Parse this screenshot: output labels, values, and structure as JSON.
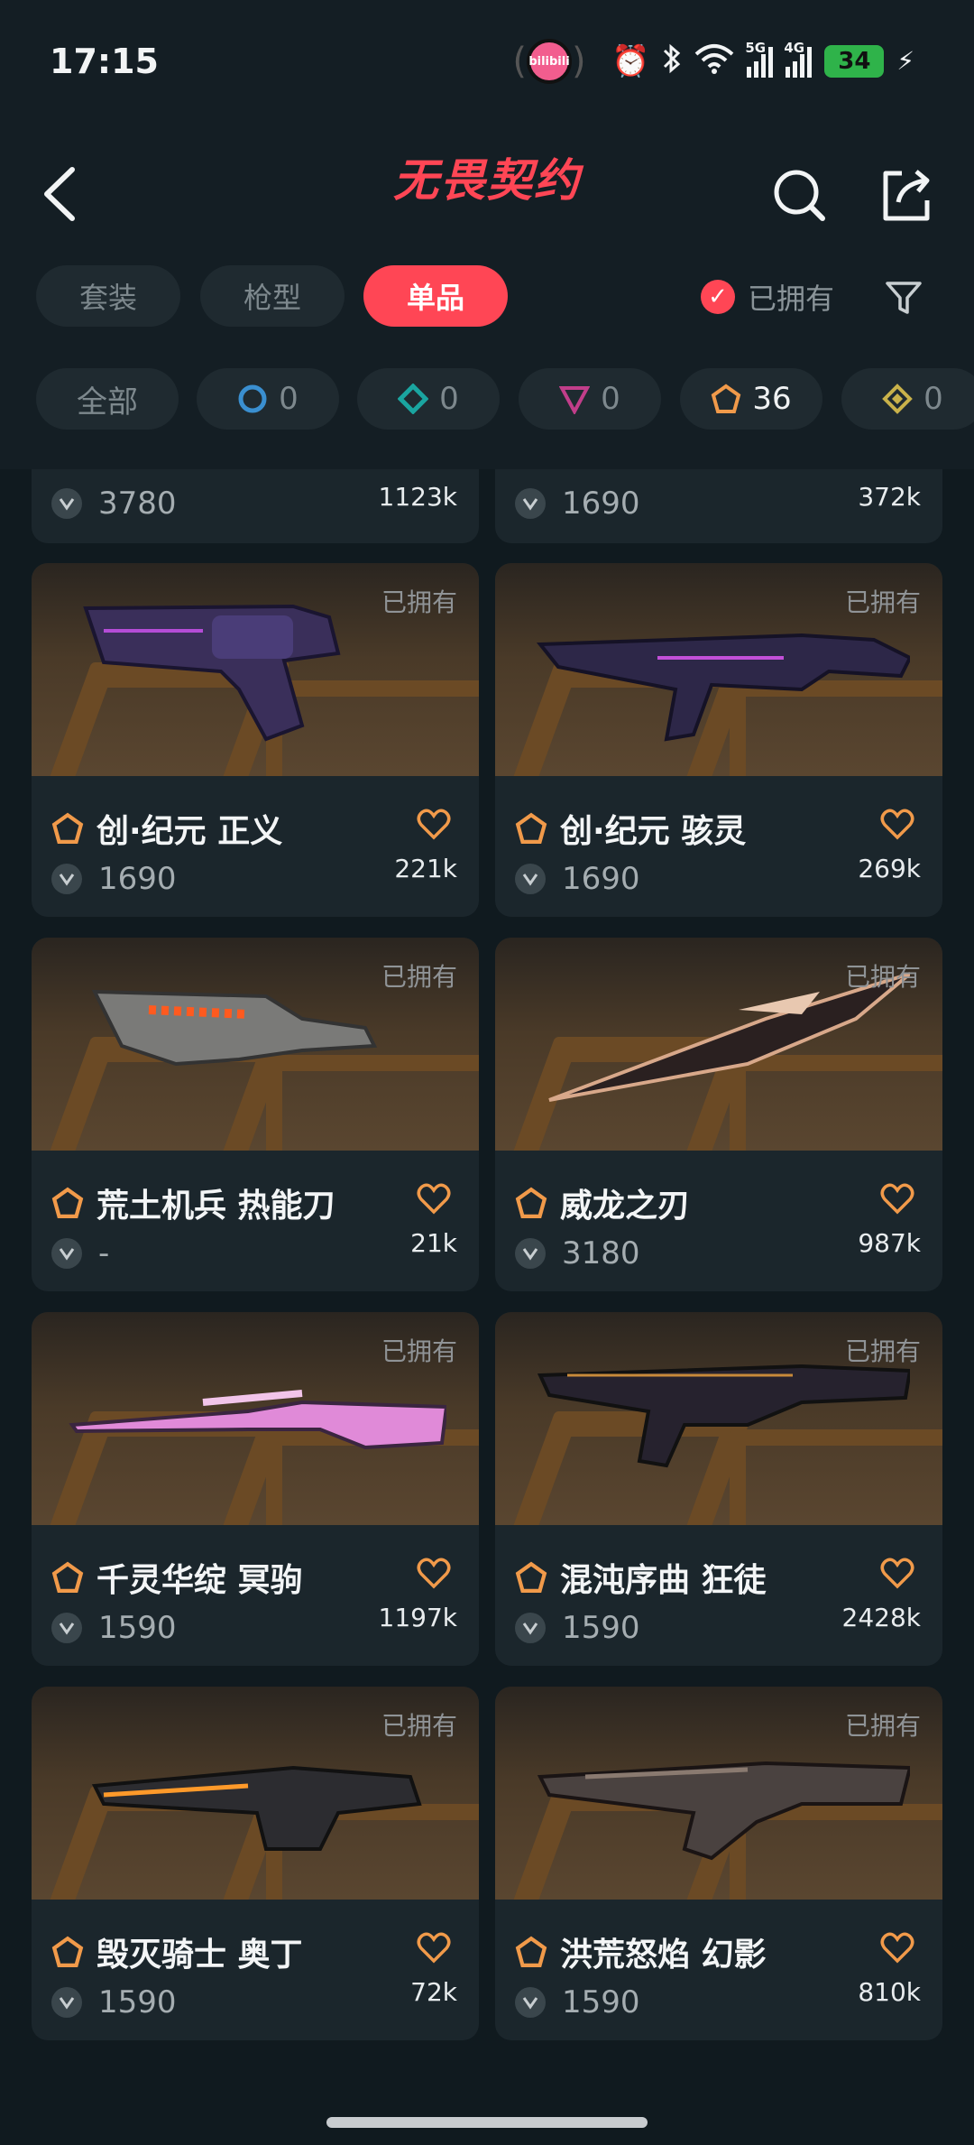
{
  "status_bar": {
    "time": "17:15",
    "battery": "34",
    "network_1": "5G",
    "network_2": "4G",
    "app_badge": "bilibili"
  },
  "header": {
    "title": "无畏契约"
  },
  "tabs": [
    {
      "label": "套装",
      "active": false
    },
    {
      "label": "枪型",
      "active": false
    },
    {
      "label": "单品",
      "active": true
    }
  ],
  "owned_filter": {
    "label": "已拥有",
    "checked": true
  },
  "rarity_chips": [
    {
      "label": "全部",
      "tier": "all",
      "color": ""
    },
    {
      "label": "0",
      "tier": "select",
      "color": "#3a8fd0"
    },
    {
      "label": "0",
      "tier": "deluxe",
      "color": "#1aa5a0"
    },
    {
      "label": "0",
      "tier": "premium",
      "color": "#c13e8a"
    },
    {
      "label": "36",
      "tier": "exclusive",
      "color": "#f19a4a"
    },
    {
      "label": "0",
      "tier": "ultra",
      "color": "#c9b24a"
    }
  ],
  "partial_cards": [
    {
      "price": "3780",
      "likes": "1123k"
    },
    {
      "price": "1690",
      "likes": "372k"
    }
  ],
  "cards": [
    {
      "name": "创·纪元 正义",
      "price": "1690",
      "likes": "221k",
      "owned": "已拥有",
      "weapon": "revolver"
    },
    {
      "name": "创·纪元 骇灵",
      "price": "1690",
      "likes": "269k",
      "owned": "已拥有",
      "weapon": "smg"
    },
    {
      "name": "荒土机兵 热能刀",
      "price": "-",
      "likes": "21k",
      "owned": "已拥有",
      "weapon": "knife-heat"
    },
    {
      "name": "威龙之刃",
      "price": "3180",
      "likes": "987k",
      "owned": "已拥有",
      "weapon": "knife-blade"
    },
    {
      "name": "千灵华绽 冥驹",
      "price": "1590",
      "likes": "1197k",
      "owned": "已拥有",
      "weapon": "sniper"
    },
    {
      "name": "混沌序曲 狂徒",
      "price": "1590",
      "likes": "2428k",
      "owned": "已拥有",
      "weapon": "rifle"
    },
    {
      "name": "毁灭骑士 奥丁",
      "price": "1590",
      "likes": "72k",
      "owned": "已拥有",
      "weapon": "lmg"
    },
    {
      "name": "洪荒怒焰 幻影",
      "price": "1590",
      "likes": "810k",
      "owned": "已拥有",
      "weapon": "rifle-phantom"
    }
  ]
}
